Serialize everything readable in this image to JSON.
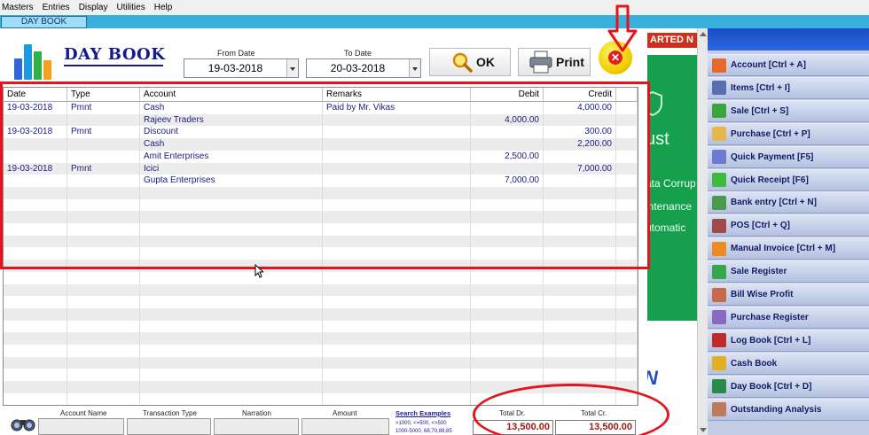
{
  "menu": [
    "Masters",
    "Entries",
    "Display",
    "Utilities",
    "Help"
  ],
  "tab": {
    "label": "DAY BOOK"
  },
  "header": {
    "title": "DAY BOOK",
    "from_date_label": "From Date",
    "from_date": "19-03-2018",
    "to_date_label": "To Date",
    "to_date": "20-03-2018",
    "ok_label": "OK",
    "print_label": "Print",
    "close_icon": "close-icon"
  },
  "grid": {
    "columns": [
      "Date",
      "Type",
      "Account",
      "Remarks",
      "Debit",
      "Credit"
    ],
    "rows": [
      [
        "19-03-2018",
        "Pmnt",
        "Cash",
        "Paid by Mr. Vikas",
        "",
        "4,000.00"
      ],
      [
        "",
        "",
        "Rajeev Traders",
        "",
        "4,000.00",
        ""
      ],
      [
        "19-03-2018",
        "Pmnt",
        "Discount",
        "",
        "",
        "300.00"
      ],
      [
        "",
        "",
        "Cash",
        "",
        "",
        "2,200.00"
      ],
      [
        "",
        "",
        "Amit Enterprises",
        "",
        "2,500.00",
        ""
      ],
      [
        "19-03-2018",
        "Pmnt",
        "Icici",
        "",
        "",
        "7,000.00"
      ],
      [
        "",
        "",
        "Gupta Enterprises",
        "",
        "7,000.00",
        ""
      ]
    ]
  },
  "bottom": {
    "account_name_label": "Account Name",
    "transaction_type_label": "Transaction Type",
    "narration_label": "Narration",
    "amount_label": "Amount",
    "search_examples_label": "Search Examples",
    "search_examples_line1": ">1000,  <=500,  <>500",
    "search_examples_line2": "1000-5000,     68,70,89,85",
    "total_dr_label": "Total Dr.",
    "total_dr": "13,500.00",
    "total_cr_label": "Total Cr.",
    "total_cr": "13,500.00"
  },
  "background": {
    "banner_text": "ARTED N",
    "line1": "ust",
    "line2": "ata Corrup",
    "line3": "intenance",
    "line4": "utomatic",
    "blue_text": "N"
  },
  "sidebar": {
    "items": [
      {
        "label": "Account [Ctrl + A]",
        "icon": "account-icon",
        "color": "#e8682a"
      },
      {
        "label": "Items [Ctrl + I]",
        "icon": "items-icon",
        "color": "#5a6fb0"
      },
      {
        "label": "Sale [Ctrl + S]",
        "icon": "sale-icon",
        "color": "#3aa63a"
      },
      {
        "label": "Purchase [Ctrl + P]",
        "icon": "purchase-icon",
        "color": "#e6b84a"
      },
      {
        "label": "Quick Payment [F5]",
        "icon": "quick-payment-icon",
        "color": "#6a7bd0"
      },
      {
        "label": "Quick Receipt [F6]",
        "icon": "quick-receipt-icon",
        "color": "#3dbb3d"
      },
      {
        "label": "Bank entry [Ctrl + N]",
        "icon": "bank-entry-icon",
        "color": "#4a9a4a"
      },
      {
        "label": "POS [Ctrl + Q]",
        "icon": "pos-icon",
        "color": "#a04a4a"
      },
      {
        "label": "Manual Invoice [Ctrl + M]",
        "icon": "manual-invoice-icon",
        "color": "#f08a1c"
      },
      {
        "label": "Sale Register",
        "icon": "sale-register-icon",
        "color": "#36a84c"
      },
      {
        "label": "Bill Wise Profit",
        "icon": "bill-wise-profit-icon",
        "color": "#c86a4a"
      },
      {
        "label": "Purchase Register",
        "icon": "purchase-register-icon",
        "color": "#8a6ac0"
      },
      {
        "label": "Log Book [Ctrl + L]",
        "icon": "log-book-icon",
        "color": "#c02a2a"
      },
      {
        "label": "Cash Book",
        "icon": "cash-book-icon",
        "color": "#e0b020"
      },
      {
        "label": "Day Book [Ctrl + D]",
        "icon": "day-book-icon",
        "color": "#2a8a4a"
      },
      {
        "label": "Outstanding Analysis",
        "icon": "outstanding-analysis-icon",
        "color": "#c07a5a"
      }
    ]
  }
}
